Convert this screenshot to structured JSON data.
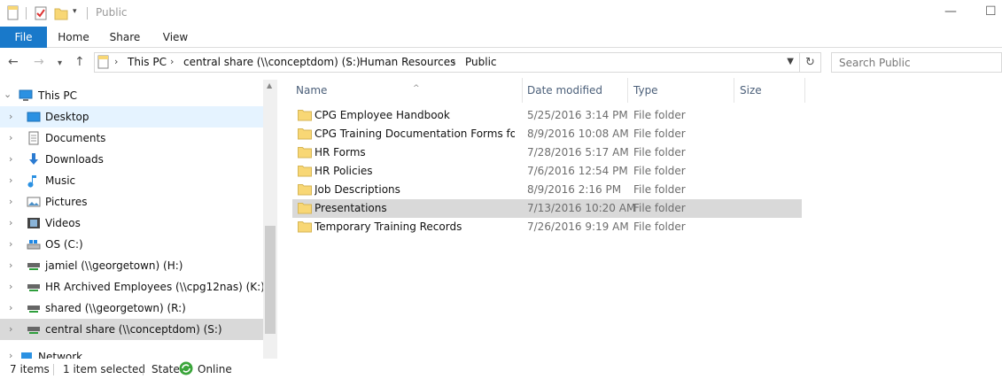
{
  "window": {
    "title": "Public"
  },
  "ribbon": {
    "tabs": [
      "File",
      "Home",
      "Share",
      "View"
    ]
  },
  "address": {
    "segments": [
      "This PC",
      "central share (\\\\conceptdom) (S:)",
      "Human Resources",
      "Public"
    ]
  },
  "search": {
    "placeholder": "Search Public"
  },
  "nav": {
    "items": [
      {
        "label": "This PC",
        "icon": "computer-icon",
        "state": "expanded"
      },
      {
        "label": "Desktop",
        "icon": "desktop-icon",
        "state": "hover"
      },
      {
        "label": "Documents",
        "icon": "documents-icon"
      },
      {
        "label": "Downloads",
        "icon": "downloads-icon"
      },
      {
        "label": "Music",
        "icon": "music-icon"
      },
      {
        "label": "Pictures",
        "icon": "pictures-icon"
      },
      {
        "label": "Videos",
        "icon": "videos-icon"
      },
      {
        "label": "OS (C:)",
        "icon": "drive-icon"
      },
      {
        "label": "jamiel (\\\\georgetown) (H:)",
        "icon": "network-drive-icon"
      },
      {
        "label": "HR Archived Employees (\\\\cpg12nas) (K:)",
        "icon": "network-drive-icon"
      },
      {
        "label": "shared (\\\\georgetown) (R:)",
        "icon": "network-drive-icon"
      },
      {
        "label": "central share (\\\\conceptdom) (S:)",
        "icon": "network-drive-icon",
        "state": "selected"
      },
      {
        "label": "Network",
        "icon": "network-icon"
      }
    ]
  },
  "columns": {
    "name": "Name",
    "date": "Date modified",
    "type": "Type",
    "size": "Size"
  },
  "files": [
    {
      "name": "CPG Employee Handbook",
      "date": "5/25/2016 3:14 PM",
      "type": "File folder"
    },
    {
      "name": "CPG Training Documentation Forms for ...",
      "date": "8/9/2016 10:08 AM",
      "type": "File folder"
    },
    {
      "name": "HR Forms",
      "date": "7/28/2016 5:17 AM",
      "type": "File folder"
    },
    {
      "name": "HR Policies",
      "date": "7/6/2016 12:54 PM",
      "type": "File folder"
    },
    {
      "name": "Job Descriptions",
      "date": "8/9/2016 2:16 PM",
      "type": "File folder"
    },
    {
      "name": "Presentations",
      "date": "7/13/2016 10:20 AM",
      "type": "File folder",
      "selected": true
    },
    {
      "name": "Temporary Training Records",
      "date": "7/26/2016 9:19 AM",
      "type": "File folder"
    }
  ],
  "status": {
    "items_count": "7 items",
    "selected": "1 item selected",
    "state_label": "State:",
    "state_value": "Online"
  },
  "colors": {
    "file_tab": "#1979ca",
    "selection": "#d9d9d9",
    "hover": "#e5f3ff",
    "folder": "#f8d775"
  }
}
